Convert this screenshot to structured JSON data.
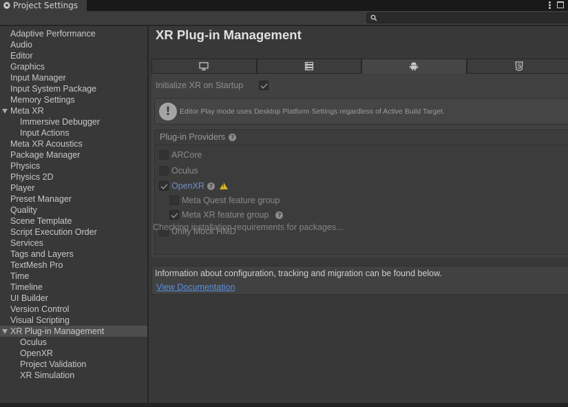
{
  "window": {
    "tab_title": "Project Settings"
  },
  "sidebar": {
    "items": [
      {
        "label": "Adaptive Performance",
        "level": 0
      },
      {
        "label": "Audio",
        "level": 0
      },
      {
        "label": "Editor",
        "level": 0
      },
      {
        "label": "Graphics",
        "level": 0
      },
      {
        "label": "Input Manager",
        "level": 0
      },
      {
        "label": "Input System Package",
        "level": 0
      },
      {
        "label": "Memory Settings",
        "level": 0
      },
      {
        "label": "Meta XR",
        "level": 0,
        "expanded": true
      },
      {
        "label": "Immersive Debugger",
        "level": 1
      },
      {
        "label": "Input Actions",
        "level": 1
      },
      {
        "label": "Meta XR Acoustics",
        "level": 0
      },
      {
        "label": "Package Manager",
        "level": 0
      },
      {
        "label": "Physics",
        "level": 0
      },
      {
        "label": "Physics 2D",
        "level": 0
      },
      {
        "label": "Player",
        "level": 0
      },
      {
        "label": "Preset Manager",
        "level": 0
      },
      {
        "label": "Quality",
        "level": 0
      },
      {
        "label": "Scene Template",
        "level": 0
      },
      {
        "label": "Script Execution Order",
        "level": 0
      },
      {
        "label": "Services",
        "level": 0
      },
      {
        "label": "Tags and Layers",
        "level": 0
      },
      {
        "label": "TextMesh Pro",
        "level": 0
      },
      {
        "label": "Time",
        "level": 0
      },
      {
        "label": "Timeline",
        "level": 0
      },
      {
        "label": "UI Builder",
        "level": 0
      },
      {
        "label": "Version Control",
        "level": 0
      },
      {
        "label": "Visual Scripting",
        "level": 0
      },
      {
        "label": "XR Plug-in Management",
        "level": 0,
        "expanded": true,
        "selected": true
      },
      {
        "label": "Oculus",
        "level": 1
      },
      {
        "label": "OpenXR",
        "level": 1
      },
      {
        "label": "Project Validation",
        "level": 1
      },
      {
        "label": "XR Simulation",
        "level": 1
      }
    ]
  },
  "main": {
    "title": "XR Plug-in Management",
    "platform_tabs": [
      {
        "icon": "desktop-icon",
        "active": false
      },
      {
        "icon": "server-icon",
        "active": false
      },
      {
        "icon": "android-icon",
        "active": true
      },
      {
        "icon": "html5-icon",
        "active": false
      }
    ],
    "init_xr_label": "Initialize XR on Startup",
    "init_xr_checked": true,
    "help_message": "Editor Play mode uses Desktop Platform Settings regardless of Active Build Target.",
    "providers_header": "Plug-in Providers",
    "providers": {
      "arcore": {
        "label": "ARCore",
        "checked": false
      },
      "oculus": {
        "label": "Oculus",
        "checked": false
      },
      "openxr": {
        "label": "OpenXR",
        "checked": true
      },
      "meta_quest_group": {
        "label": "Meta Quest feature group",
        "checked": false
      },
      "meta_xr_group": {
        "label": "Meta XR feature group",
        "checked": true
      },
      "unity_mock": {
        "label": "Unity Mock HMD",
        "checked": false
      }
    },
    "status": "Checking installation requirements for packages...",
    "info_text": "Information about configuration, tracking and migration can be found below.",
    "doc_link": "View Documentation"
  }
}
